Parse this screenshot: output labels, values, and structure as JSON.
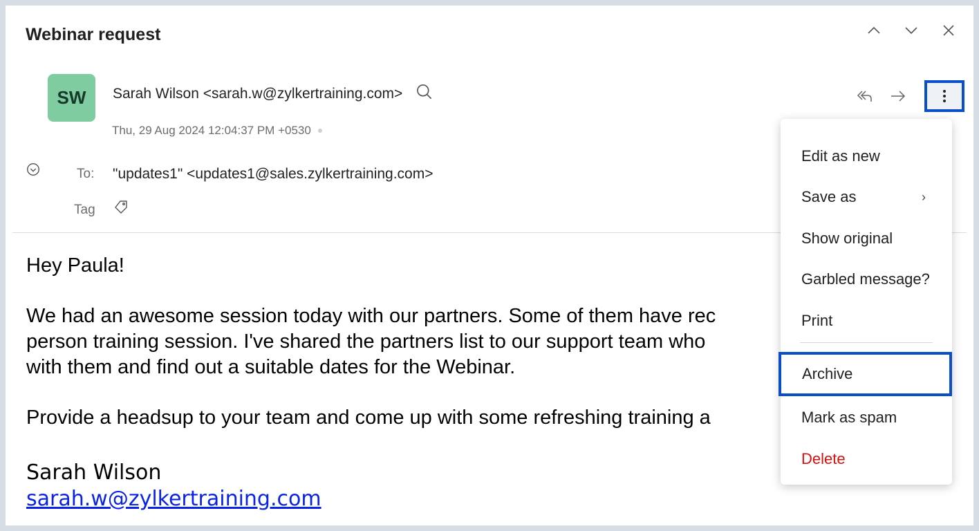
{
  "email": {
    "subject": "Webinar request",
    "avatar_initials": "SW",
    "from": "Sarah Wilson <sarah.w@zylkertraining.com>",
    "date": "Thu, 29 Aug 2024 12:04:37 PM +0530",
    "to_label": "To:",
    "to_value": "\"updates1\" <updates1@sales.zylkertraining.com>",
    "tag_label": "Tag",
    "body": [
      "Hey Paula!",
      "We had an awesome session today with our partners. Some of them have req person training session. I've shared the partners list to our support team who with them and find out a suitable dates for the Webinar.",
      "Provide a headsup to your team and come up with some refreshing training a"
    ],
    "body_lines": [
      "Hey Paula!",
      "We had an awesome session today with our partners. Some of them have rec",
      "person training session. I've shared the partners list to our support team who",
      "with them and find out a suitable dates for the Webinar.",
      "Provide a headsup to your team and come up with some refreshing training a"
    ],
    "signature_name": "Sarah Wilson",
    "signature_email": "sarah.w@zylkertraining.com"
  },
  "menu": {
    "items": [
      {
        "label": "Edit as new"
      },
      {
        "label": "Save as",
        "has_submenu": true
      },
      {
        "label": "Show original"
      },
      {
        "label": "Garbled message?"
      },
      {
        "label": "Print"
      },
      {
        "label": "Archive",
        "highlighted": true
      },
      {
        "label": "Mark as spam"
      },
      {
        "label": "Delete",
        "danger": true
      }
    ]
  },
  "icons": [
    "chevron-up-icon",
    "chevron-down-icon",
    "close-icon",
    "search-icon",
    "reply-all-icon",
    "forward-icon",
    "more-vertical-icon",
    "expand-circle-icon",
    "tag-icon"
  ],
  "colors": {
    "avatar_bg": "#7fcca0",
    "highlight_border": "#0a4fc7",
    "delete_red": "#d60f0f",
    "link_blue": "#0a23e8"
  }
}
